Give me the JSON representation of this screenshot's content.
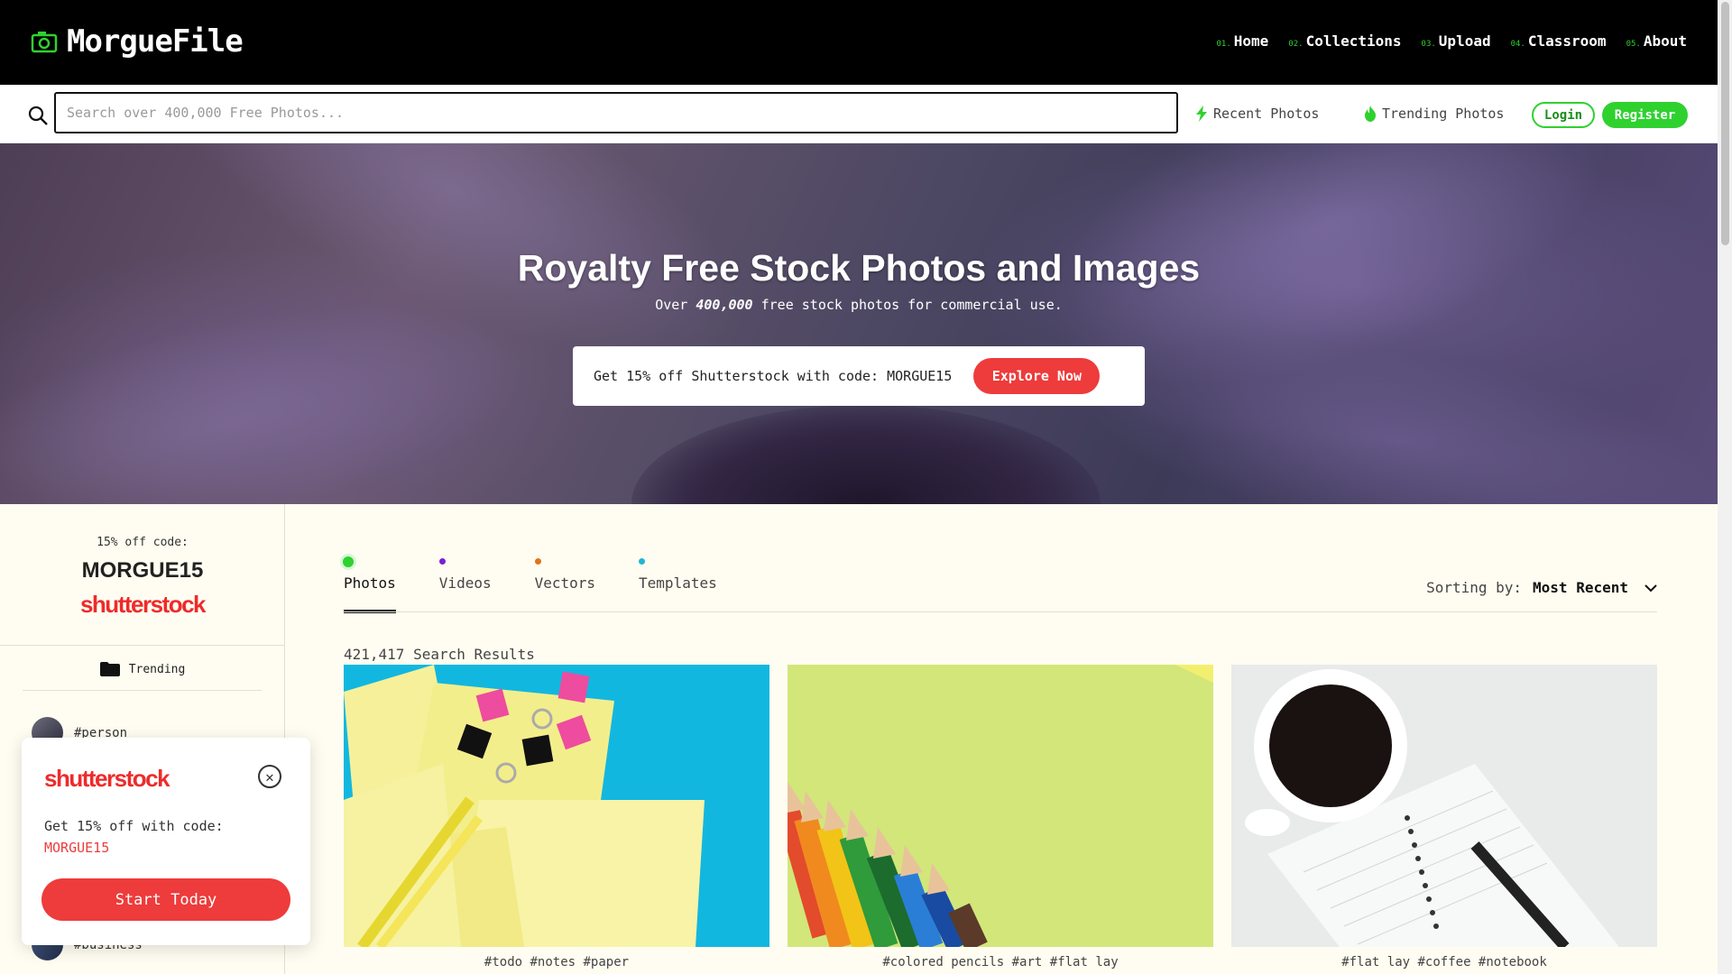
{
  "brand": {
    "name": "MorgueFile",
    "accent": "#2fd12f"
  },
  "nav": [
    {
      "num": "01.",
      "label": "Home"
    },
    {
      "num": "02.",
      "label": "Collections"
    },
    {
      "num": "03.",
      "label": "Upload"
    },
    {
      "num": "04.",
      "label": "Classroom"
    },
    {
      "num": "05.",
      "label": "About"
    }
  ],
  "search": {
    "placeholder": "Search over 400,000 Free Photos...",
    "value": "",
    "recent_label": "Recent Photos",
    "trending_label": "Trending Photos",
    "login_label": "Login",
    "register_label": "Register"
  },
  "hero": {
    "title": "Royalty Free Stock Photos and Images",
    "sub_prefix": "Over",
    "sub_count": "400,000",
    "sub_suffix": "free stock photos for commercial use.",
    "promo_text": "Get 15% off Shutterstock with code: MORGUE15",
    "promo_button": "Explore Now"
  },
  "sidebar": {
    "code_label": "15% off code:",
    "code": "MORGUE15",
    "brand": "shutterstock",
    "trending_label": "Trending",
    "tags": [
      "#person",
      "#business"
    ]
  },
  "popup": {
    "brand": "shutterstock",
    "text": "Get 15% off with code:",
    "code": "MORGUE15",
    "button": "Start Today",
    "close_icon": "close-icon"
  },
  "tabs": [
    {
      "label": "Photos",
      "dot": "#2fd12f",
      "active": true
    },
    {
      "label": "Videos",
      "dot": "#7a1fd6",
      "active": false
    },
    {
      "label": "Vectors",
      "dot": "#e2731b",
      "active": false
    },
    {
      "label": "Templates",
      "dot": "#1fb6d6",
      "active": false
    }
  ],
  "sorting": {
    "label": "Sorting by:",
    "value": "Most Recent"
  },
  "results": {
    "count_text": "421,417 Search Results"
  },
  "photos": [
    {
      "tags": "#todo #notes #paper"
    },
    {
      "tags": "#colored pencils #art #flat lay"
    },
    {
      "tags": "#flat lay #coffee #notebook"
    }
  ]
}
